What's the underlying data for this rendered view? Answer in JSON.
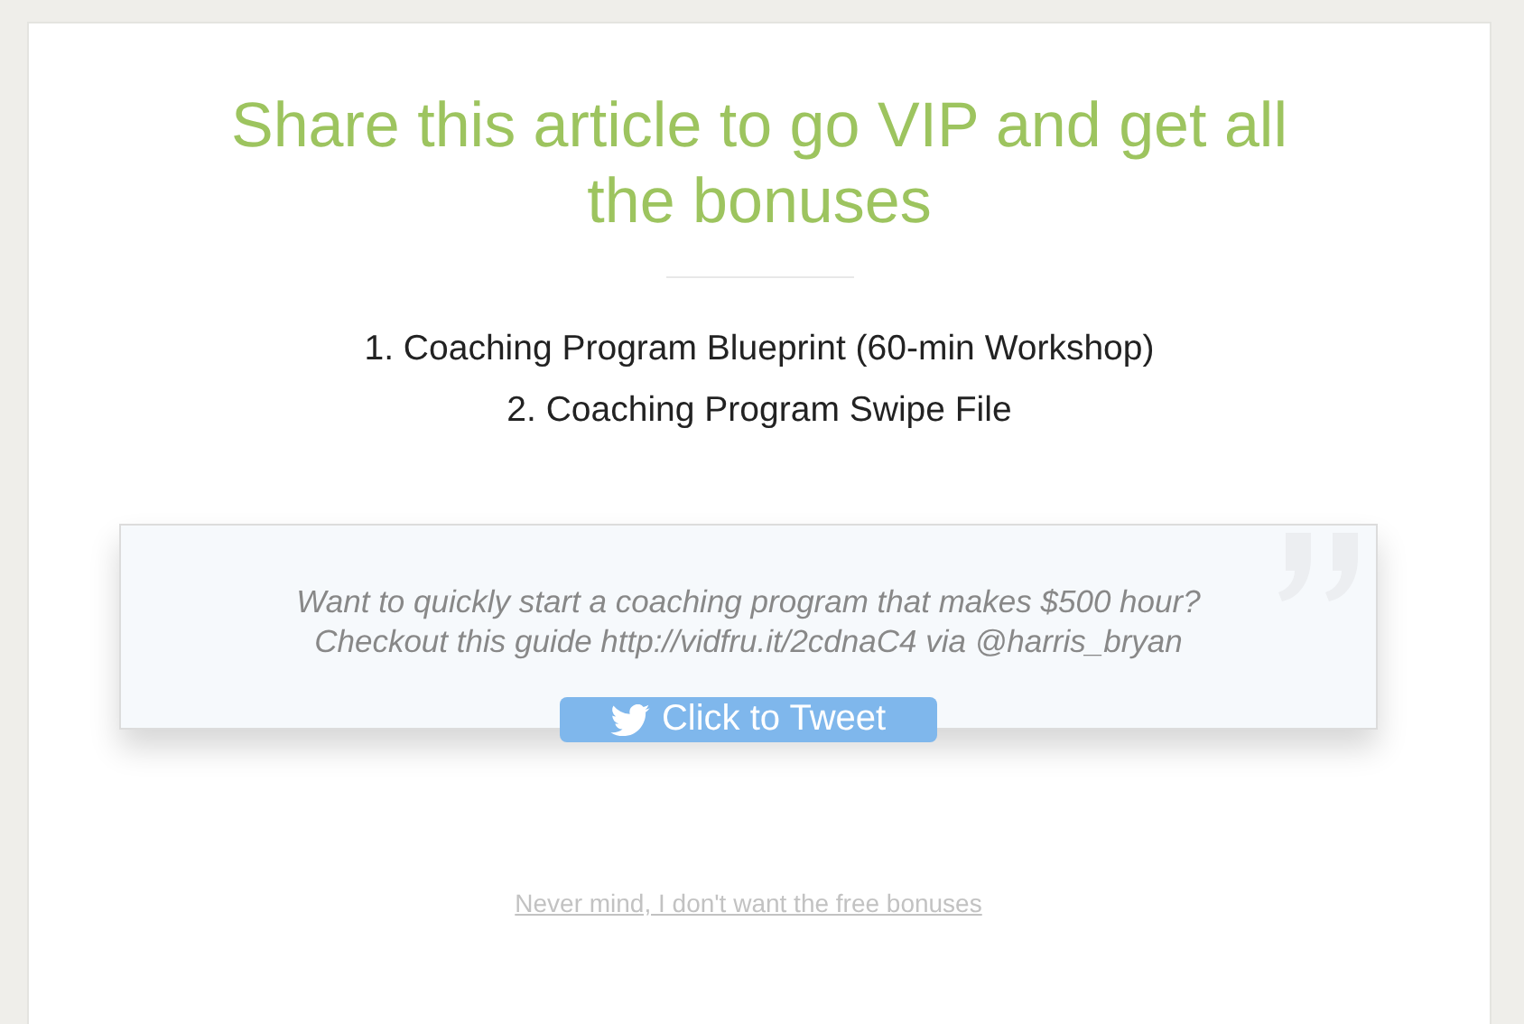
{
  "title": "Share this article to go VIP and get all the bonuses",
  "bonuses": [
    "1. Coaching Program Blueprint (60-min Workshop)",
    "2. Coaching Program Swipe File"
  ],
  "tweet": {
    "text": "Want to quickly start a coaching program that makes $500 hour?\nCheckout this guide http://vidfru.it/2cdnaC4 via @harris_bryan",
    "button": "Click to Tweet"
  },
  "decline_link": "Never mind, I don't want the free bonuses"
}
